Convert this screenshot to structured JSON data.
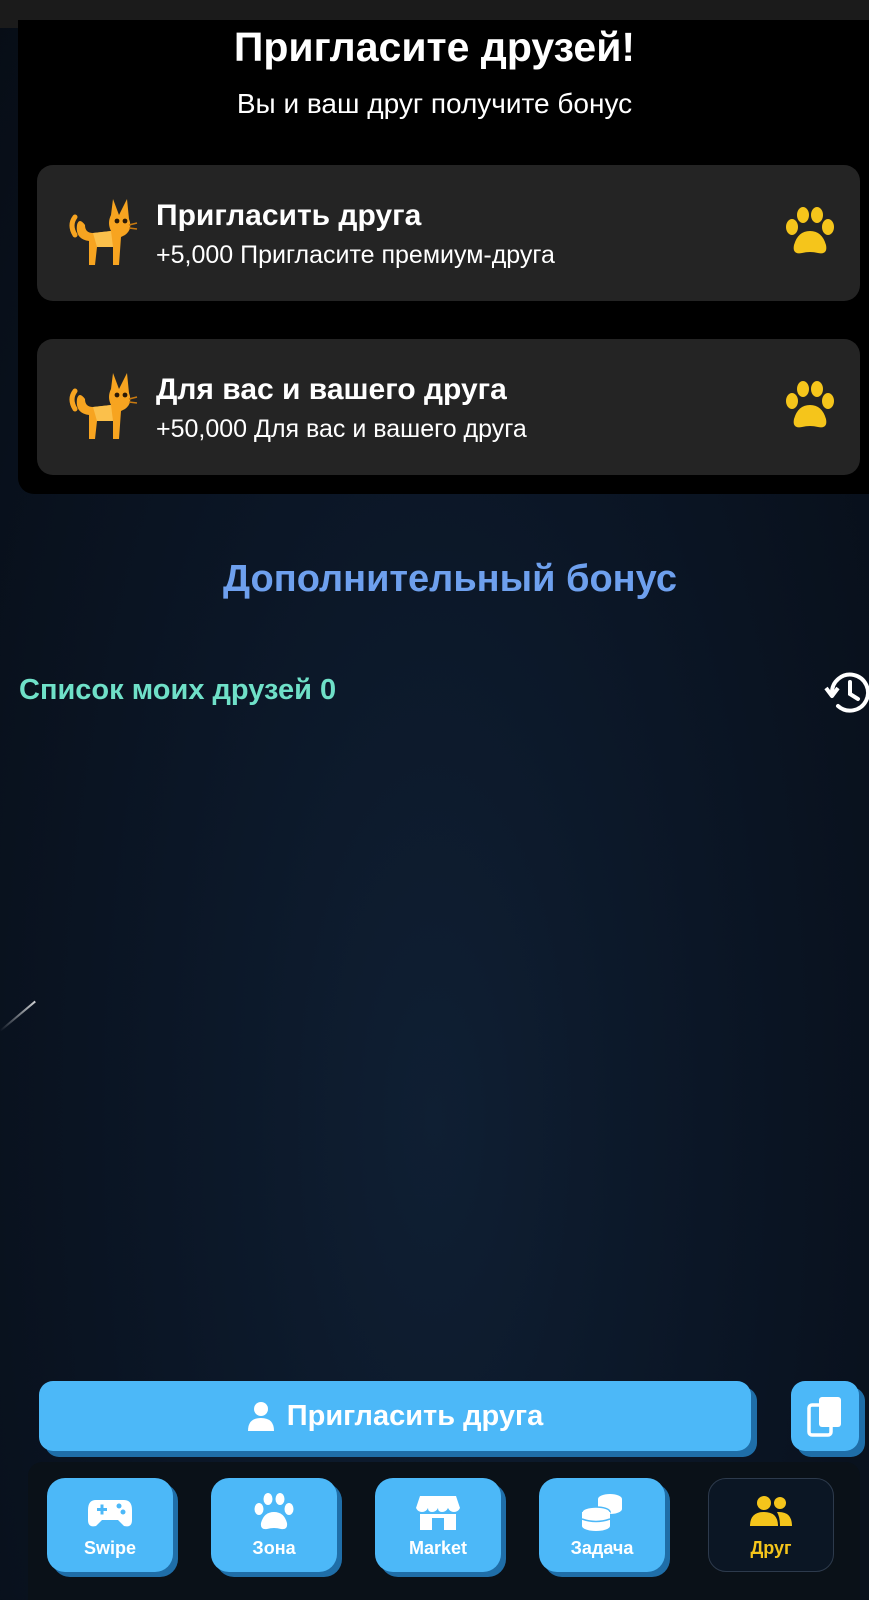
{
  "header": {
    "title": "Пригласите друзей!",
    "subtitle": "Вы и ваш друг получите бонус"
  },
  "cards": [
    {
      "title": "Пригласить друга",
      "subtitle": "+5,000 Пригласите премиум-друга",
      "icon": "cat-icon",
      "action_icon": "paw-icon"
    },
    {
      "title": "Для вас и вашего друга",
      "subtitle": "+50,000 Для вас и вашего друга",
      "icon": "cat-icon",
      "action_icon": "paw-icon"
    }
  ],
  "bonus_heading": "Дополнительный бонус",
  "friends_list_label": "Список моих друзей 0",
  "invite_button_label": "Пригласить друга",
  "nav": [
    {
      "label": "Swipe",
      "icon": "gamepad-icon",
      "active": false
    },
    {
      "label": "Зона",
      "icon": "paw-icon",
      "active": false
    },
    {
      "label": "Market",
      "icon": "store-icon",
      "active": false
    },
    {
      "label": "Задача",
      "icon": "coins-icon",
      "active": false
    },
    {
      "label": "Друг",
      "icon": "users-icon",
      "active": true
    }
  ],
  "colors": {
    "accent_blue": "#4cb8f8",
    "heading_blue": "#6ea0ee",
    "teal_label": "#6fe0c8",
    "gold": "#f5c51b",
    "card_bg": "#242424"
  }
}
